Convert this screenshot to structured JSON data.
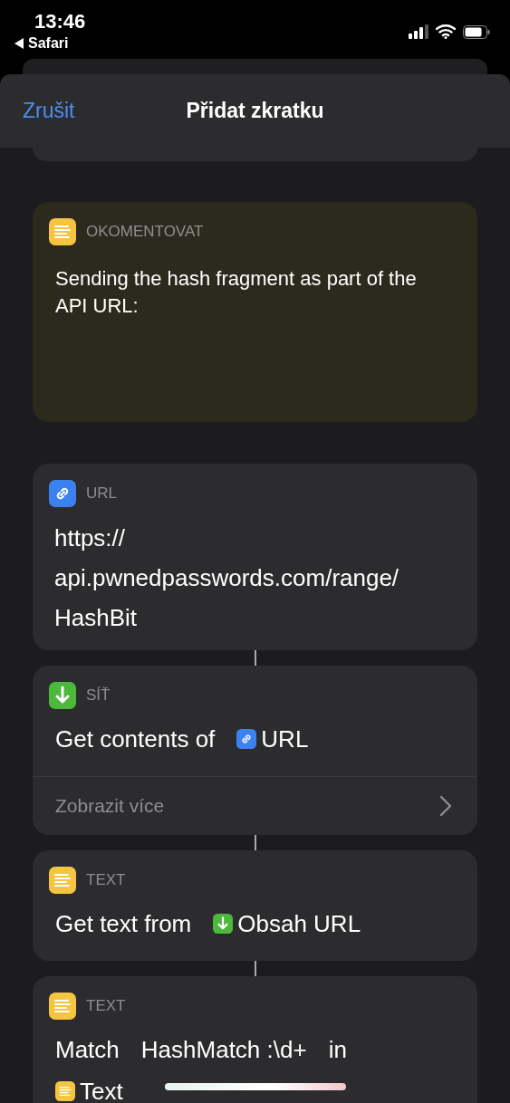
{
  "status_bar": {
    "time": "13:46",
    "back_app": "Safari"
  },
  "header": {
    "cancel": "Zrušit",
    "title": "Přidat zkratku"
  },
  "actions": [
    {
      "kind": "comment",
      "category": "OKOMENTOVAT",
      "text": "Sending the hash fragment as part of the API URL:"
    },
    {
      "kind": "url",
      "category": "URL",
      "lines": [
        [
          {
            "kind": "parameter",
            "text": "https://"
          }
        ],
        [
          {
            "kind": "parameter",
            "text": "api.pwnedpasswords.com/range/"
          }
        ],
        [
          {
            "kind": "parameter",
            "text": "HashBit"
          }
        ]
      ]
    },
    {
      "kind": "network",
      "category": "SÍŤ",
      "lines": [
        [
          {
            "kind": "parameter",
            "text": "Get contents of"
          },
          {
            "kind": "url_variable",
            "text": "URL"
          }
        ]
      ],
      "show_more": "Zobrazit více"
    },
    {
      "kind": "text",
      "category": "TEXT",
      "lines": [
        [
          {
            "kind": "parameter",
            "text": "Get text from"
          },
          {
            "kind": "network_variable",
            "text": "Obsah URL"
          }
        ]
      ]
    },
    {
      "kind": "text",
      "category": "TEXT",
      "lines": [
        [
          {
            "kind": "parameter",
            "text": "Match"
          },
          {
            "kind": "parameter",
            "text": "HashMatch :\\d+"
          },
          {
            "kind": "parameter",
            "text": "in"
          }
        ],
        [
          {
            "kind": "text_variable",
            "text": "Text"
          }
        ]
      ]
    }
  ]
}
